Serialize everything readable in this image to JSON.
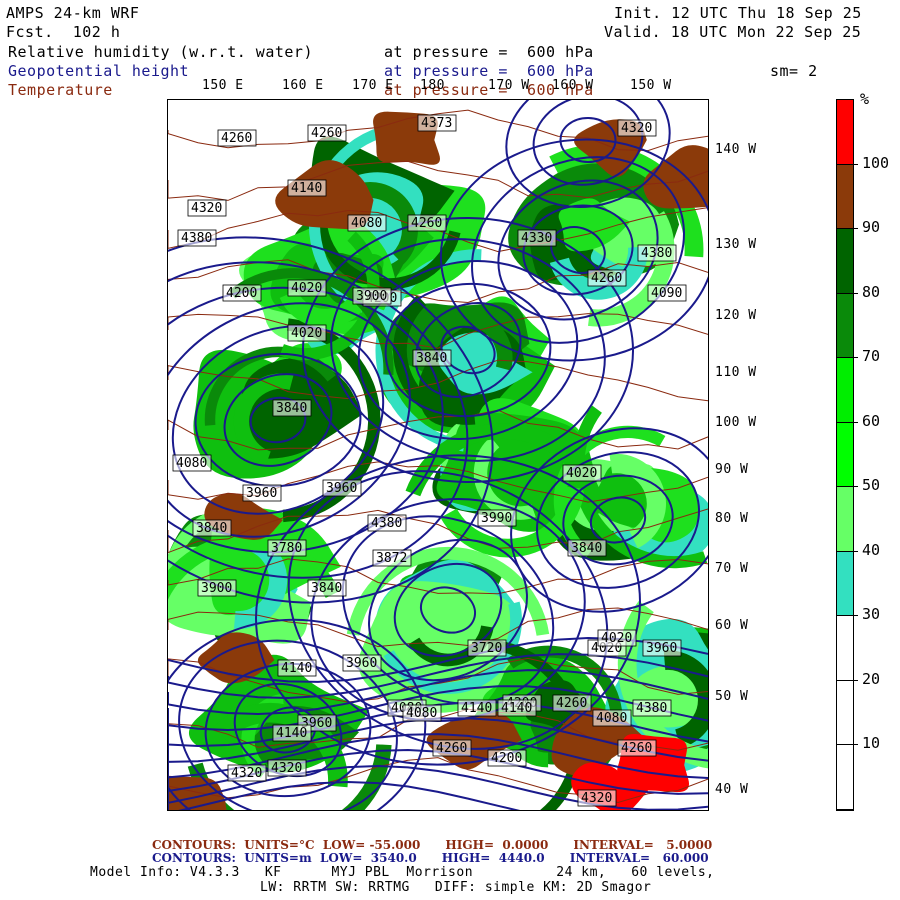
{
  "header": {
    "model": "AMPS 24-km WRF",
    "forecast": "Fcst.  102 h",
    "init": "Init. 12 UTC Thu 18 Sep 25",
    "valid": "Valid. 18 UTC Mon 22 Sep 25",
    "field1_name": "Relative humidity (w.r.t. water)",
    "field1_level": "at pressure =  600 hPa",
    "field2_name": "Geopotential height",
    "field2_level": "at pressure =  600 hPa",
    "field3_name": "Temperature",
    "field3_level": "at pressure =  600 hPa",
    "smoothing": "sm= 2"
  },
  "colors": {
    "height_contour": "#1a1a8c",
    "temp_contour": "#8a2a10",
    "rh_30": "#33e0c0",
    "rh_40": "#66ff66",
    "rh_50": "#1ee01e",
    "rh_60": "#0fbf0f",
    "rh_70": "#0a8a0a",
    "rh_80": "#006400",
    "rh_90": "#8b3a0a",
    "rh_100": "#ff0000"
  },
  "lon_top": [
    "150 E",
    "160 E",
    "170 E",
    "180",
    "170 W",
    "160 W",
    "150 W"
  ],
  "lon_right": [
    "140 W",
    "130 W",
    "120 W",
    "110 W",
    "100 W",
    "90 W",
    "80 W",
    "70 W",
    "60 W",
    "50 W",
    "40 W"
  ],
  "colorbar": {
    "unit": "%",
    "labels": [
      "100",
      "90",
      "80",
      "70",
      "60",
      "50",
      "40",
      "30",
      "20",
      "10"
    ],
    "segments": [
      {
        "range": "100+",
        "color": "#ff0000"
      },
      {
        "range": "90-100",
        "color": "#8b3a0a"
      },
      {
        "range": "80-90",
        "color": "#006400"
      },
      {
        "range": "70-80",
        "color": "#0a8a0a"
      },
      {
        "range": "60-70",
        "color": "#00ee00"
      },
      {
        "range": "50-60",
        "color": "#00ff00"
      },
      {
        "range": "40-50",
        "color": "#66ff66"
      },
      {
        "range": "30-40",
        "color": "#33e0c0"
      },
      {
        "range": "20-30",
        "color": "#ffffff"
      },
      {
        "range": "10-20",
        "color": "#ffffff"
      },
      {
        "range": "0-10",
        "color": "#ffffff"
      }
    ]
  },
  "height_labels": [
    "4260",
    "4260",
    "4373",
    "4320",
    "4380",
    "4140",
    "4320",
    "4330",
    "4380",
    "4080",
    "4260",
    "4200",
    "4020",
    "4200",
    "4090",
    "4020",
    "3900",
    "4260",
    "3840",
    "3840",
    "4080",
    "3960",
    "3960",
    "3990",
    "4020",
    "3840",
    "3780",
    "3840",
    "3900",
    "3872",
    "3840",
    "3720",
    "3960",
    "4020",
    "3960",
    "4020",
    "4080",
    "4140",
    "3960",
    "4080",
    "4140",
    "4200",
    "4260",
    "4380",
    "4320",
    "4140",
    "4260",
    "4320",
    "4200",
    "4260",
    "4320",
    "4380",
    "4140",
    "4080"
  ],
  "footer": {
    "temp_line": "CONTOURS:  UNITS=°C  LOW= -55.000      HIGH=  0.0000      INTERVAL=   5.0000",
    "height_line": "CONTOURS:  UNITS=m  LOW=  3540.0      HIGH=  4440.0      INTERVAL=   60.000",
    "model_info": "Model Info: V4.3.3   KF      MYJ PBL  Morrison          24 km,   60 levels,",
    "model_info2": "LW: RRTM SW: RRTMG   DIFF: simple KM: 2D Smagor"
  }
}
